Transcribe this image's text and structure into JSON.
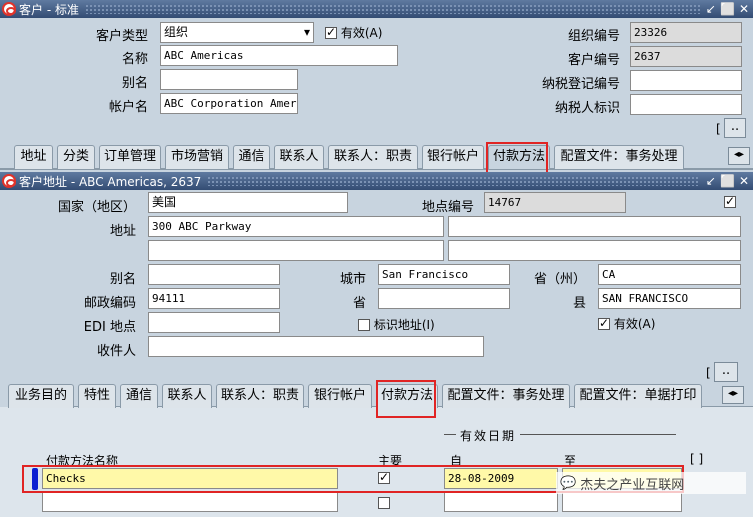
{
  "win1": {
    "title": "客户 - 标准"
  },
  "header": {
    "customer_type_label": "客户类型",
    "customer_type_value": "组织",
    "active_label": "有效(A)",
    "name_label": "名称",
    "name_value": "ABC Americas",
    "alias_label": "别名",
    "alias_value": "",
    "account_name_label": "帐户名",
    "account_name_value": "ABC Corporation Amer",
    "org_number_label": "组织编号",
    "org_number_value": "23326",
    "customer_number_label": "客户编号",
    "customer_number_value": "2637",
    "tax_reg_label": "纳税登记编号",
    "tax_reg_value": "",
    "taxpayer_label": "纳税人标识",
    "taxpayer_value": "",
    "more_btn": ".."
  },
  "tabs1": [
    "地址",
    "分类",
    "订单管理",
    "市场营销",
    "通信",
    "联系人",
    "联系人：职责",
    "银行帐户",
    "付款方法",
    "配置文件：事务处理"
  ],
  "win2": {
    "title": "客户地址 - ABC Americas, 2637"
  },
  "address": {
    "country_label": "国家（地区）",
    "country_value": "美国",
    "site_number_label": "地点编号",
    "site_number_value": "14767",
    "address_label": "地址",
    "address_line1": "300 ABC Parkway",
    "alias_label": "别名",
    "alias_value": "",
    "city_label": "城市",
    "city_value": "San Francisco",
    "province_label": "省（州）",
    "province_value": "CA",
    "postal_label": "邮政编码",
    "postal_value": "94111",
    "state_label": "省",
    "state_value": "",
    "county_label": "县",
    "county_value": "SAN FRANCISCO",
    "edi_label": "EDI 地点",
    "edi_value": "",
    "identify_label": "标识地址(I)",
    "active_label": "有效(A)",
    "recipient_label": "收件人",
    "recipient_value": "",
    "more_btn": ".."
  },
  "tabs2": [
    "业务目的",
    "特性",
    "通信",
    "联系人",
    "联系人：职责",
    "银行帐户",
    "付款方法",
    "配置文件：事务处理",
    "配置文件：单据打印"
  ],
  "pay": {
    "effective_dates": "有效日期",
    "col_name": "付款方法名称",
    "col_primary": "主要",
    "col_from": "自",
    "col_to": "至",
    "bracket": "[  ]",
    "row1_name": "Checks",
    "row1_from": "28-08-2009",
    "row1_to": ""
  },
  "watermark": "杰夫之产业互联网"
}
